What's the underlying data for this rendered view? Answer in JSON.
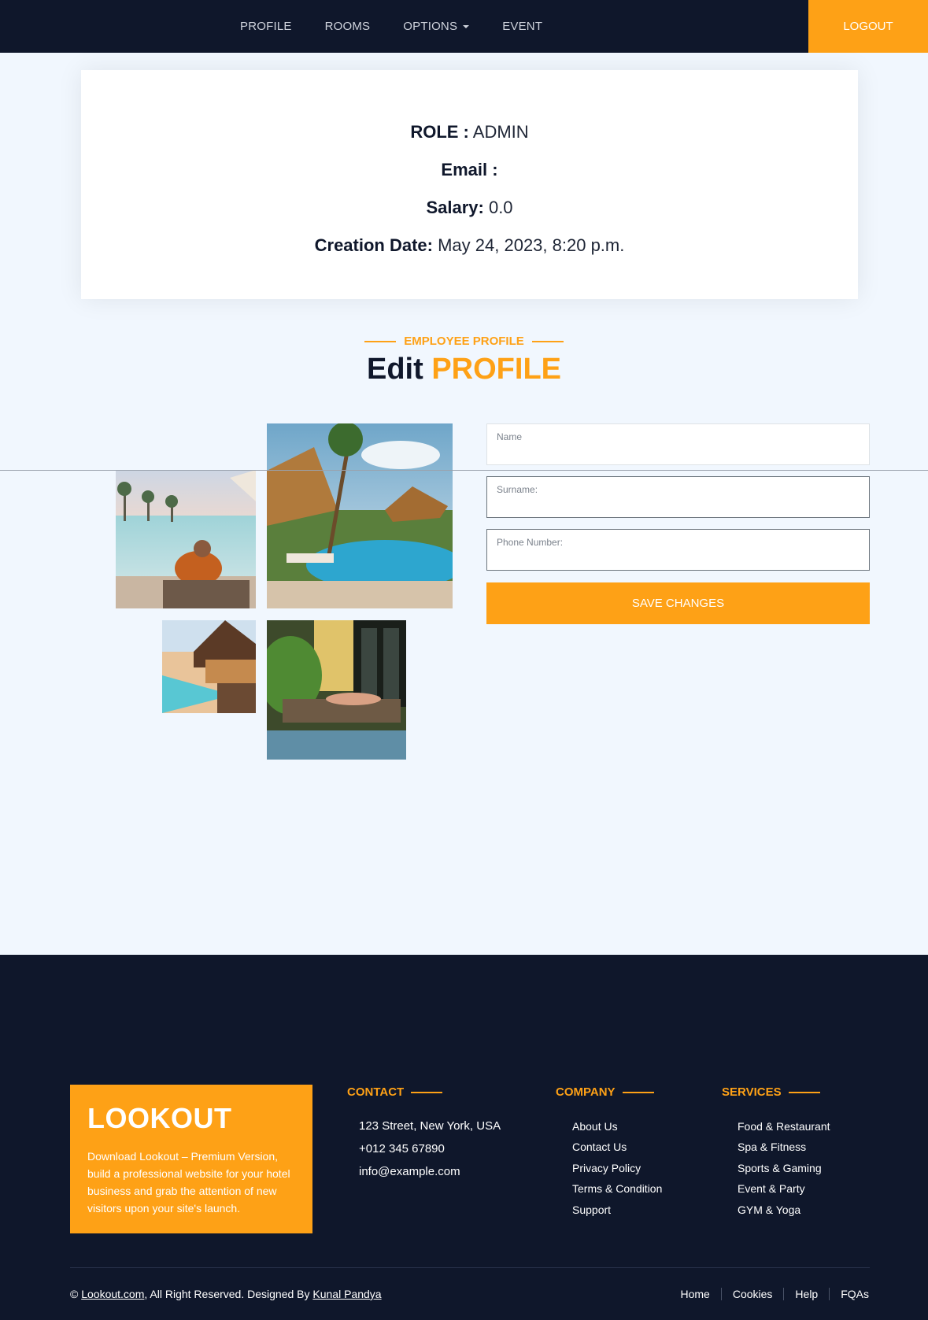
{
  "nav": {
    "items": [
      {
        "label": "PROFILE"
      },
      {
        "label": "ROOMS"
      },
      {
        "label": "OPTIONS"
      },
      {
        "label": "EVENT"
      }
    ],
    "logout_label": "LOGOUT"
  },
  "info": {
    "role_label": "ROLE :",
    "role_value": "ADMIN",
    "email_label": "Email :",
    "email_value": "",
    "salary_label": "Salary:",
    "salary_value": "0.0",
    "creation_label": "Creation Date:",
    "creation_value": "May 24, 2023, 8:20 p.m."
  },
  "section": {
    "subtitle": "EMPLOYEE PROFILE",
    "title_main": "Edit",
    "title_highlight": "PROFILE"
  },
  "form": {
    "name_placeholder": "Name",
    "surname_placeholder": "Surname:",
    "phone_placeholder": "Phone Number:",
    "save_label": "SAVE CHANGES"
  },
  "footer": {
    "brand": "LOOKOUT",
    "brand_text": "Download Lookout – Premium Version, build a professional website for your hotel business and grab the attention of new visitors upon your site's launch.",
    "contact_title": "CONTACT",
    "contact": [
      "123 Street, New York, USA",
      "+012 345 67890",
      "info@example.com"
    ],
    "company_title": "COMPANY",
    "company": [
      "About Us",
      "Contact Us",
      "Privacy Policy",
      "Terms & Condition",
      "Support"
    ],
    "services_title": "SERVICES",
    "services": [
      "Food & Restaurant",
      "Spa & Fitness",
      "Sports & Gaming",
      "Event & Party",
      "GYM & Yoga"
    ],
    "copyright_symbol": "©",
    "copyright_site": "Lookout.com",
    "copyright_middle": ", All Right Reserved. Designed By",
    "copyright_author": "Kunal Pandya",
    "bottom_links": [
      "Home",
      "Cookies",
      "Help",
      "FQAs"
    ]
  },
  "colors": {
    "navy": "#0f172b",
    "accent": "#fea116",
    "page_bg": "#f1f7fe"
  }
}
